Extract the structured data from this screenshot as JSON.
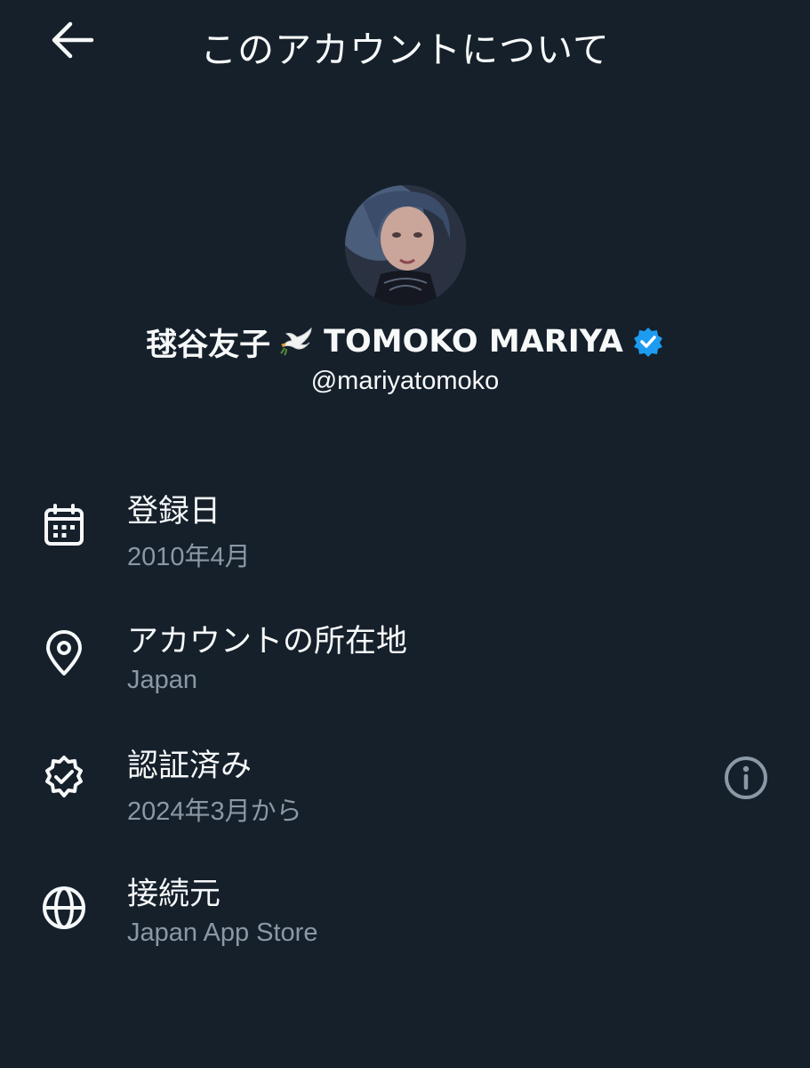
{
  "header": {
    "title": "このアカウントについて",
    "back_icon": "arrow-left-icon"
  },
  "profile": {
    "display_name": "毬谷友子",
    "display_name_latin": "TOMOKO MARIYA",
    "emoji_icon": "dove-icon",
    "verified_icon": "verified-badge-icon",
    "handle": "@mariyatomoko",
    "verified_color": "#1d9bf0"
  },
  "info": [
    {
      "icon": "calendar-icon",
      "label": "登録日",
      "value": "2010年4月"
    },
    {
      "icon": "location-pin-icon",
      "label": "アカウントの所在地",
      "value": "Japan"
    },
    {
      "icon": "verified-seal-icon",
      "label": "認証済み",
      "value": "2024年3月から",
      "action_icon": "info-icon"
    },
    {
      "icon": "globe-icon",
      "label": "接続元",
      "value": "Japan App Store"
    }
  ],
  "colors": {
    "background": "#15202b",
    "primary_text": "#f7f9f9",
    "secondary_text": "#8b98a5"
  }
}
